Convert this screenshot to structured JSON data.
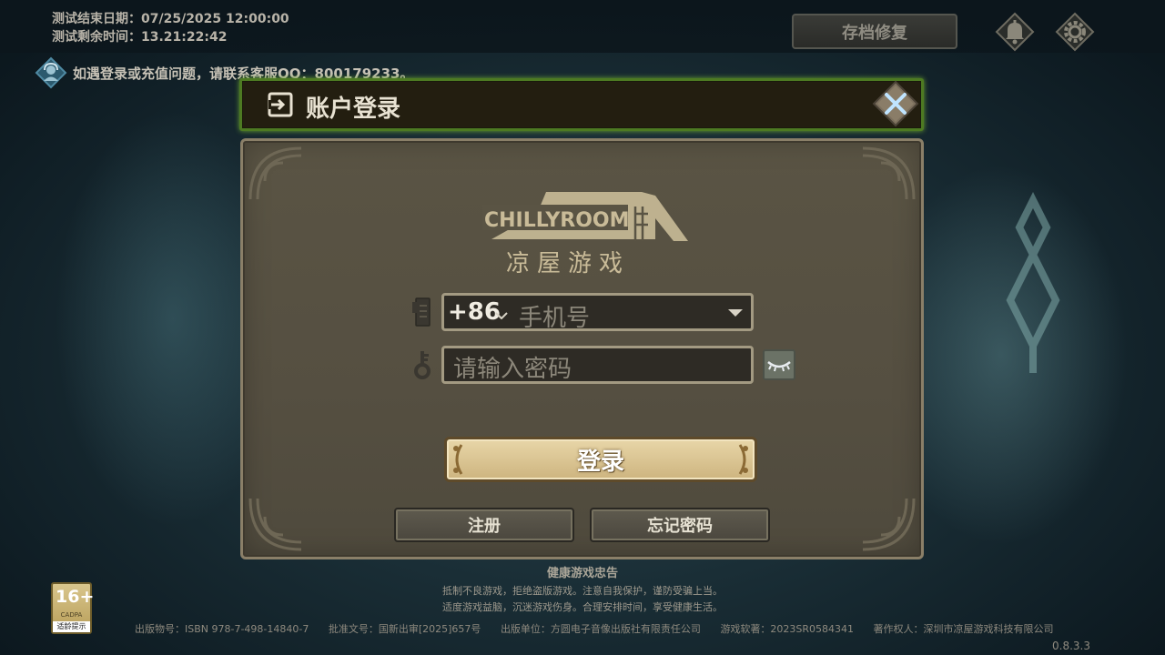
{
  "test_info": {
    "end_date_line": "测试结束日期：07/25/2025 12:00:00",
    "remaining_line": "测试剩余时间：13.21:22:42"
  },
  "top_buttons": {
    "save_repair_label": "存档修复",
    "bell_icon": "bell-icon",
    "settings_icon": "gear-icon"
  },
  "notice": {
    "text": "如遇登录或充值问题，请联系客服QQ：800179233。"
  },
  "dialog": {
    "title": "账户登录",
    "close_icon": "close-icon",
    "logo_en": "CHILLYROOM",
    "logo_cn": "凉屋游戏",
    "phone": {
      "country_code": "+86",
      "placeholder": "手机号"
    },
    "password": {
      "placeholder": "请输入密码"
    },
    "login_label": "登录",
    "register_label": "注册",
    "forgot_label": "忘记密码"
  },
  "footer": {
    "health_title": "健康游戏忠告",
    "health_line1": "抵制不良游戏，拒绝盗版游戏。注意自我保护，谨防受骗上当。",
    "health_line2": "适度游戏益脑，沉迷游戏伤身。合理安排时间，享受健康生活。",
    "pub_number": "出版物号：ISBN 978-7-498-14840-7",
    "approval": "批准文号：国新出审[2025]657号",
    "publisher": "出版单位：方圆电子音像出版社有限责任公司",
    "software": "游戏软著：2023SR0584341",
    "copyright": "著作权人：深圳市凉屋游戏科技有限公司",
    "version": "0.8.3.3"
  },
  "age_rating": {
    "age": "16+",
    "org": "CADPA",
    "tip": "适龄提示"
  },
  "colors": {
    "header_border": "#4d7a22",
    "panel_bg": "#5a5444",
    "login_button": "#e8d6a8"
  }
}
